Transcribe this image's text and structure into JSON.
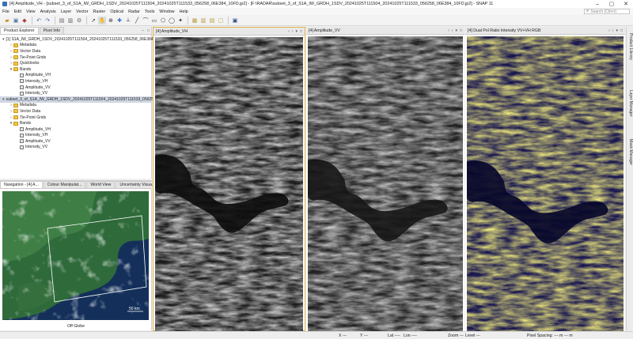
{
  "window": {
    "title": "[4] Amplitude_VH - [subset_3_of_S1A_IW_GRDH_1SDV_20241025T111504_20241025T111533_056258_06E384_10FD.jp2] - [F:\\RADAR\\subset_3_of_S1A_IW_GRDH_1SDV_20241025T111504_20241025T111533_056258_06E384_10FD.jp2] - SNAP 11",
    "minimize": "–",
    "maximize": "▢",
    "close": "✕"
  },
  "menu": [
    "File",
    "Edit",
    "View",
    "Analysis",
    "Layer",
    "Vector",
    "Raster",
    "Optical",
    "Radar",
    "Tools",
    "Window",
    "Help"
  ],
  "search": {
    "placeholder": "Search (Ctrl+I)"
  },
  "left_panel": {
    "tabs": [
      "Product Explorer",
      "Pixel Info"
    ],
    "tree": [
      {
        "indent": 0,
        "toggle": "▾",
        "icon": "product",
        "label": "[1] S1A_IW_GRDH_1SDV_20241025T111504_20241025T111533_056258_06E384_10FD"
      },
      {
        "indent": 1,
        "toggle": "›",
        "icon": "folder",
        "label": "Metadata"
      },
      {
        "indent": 1,
        "toggle": "›",
        "icon": "folder",
        "label": "Vector Data"
      },
      {
        "indent": 1,
        "toggle": "›",
        "icon": "folder",
        "label": "Tie-Point Grids"
      },
      {
        "indent": 1,
        "toggle": "›",
        "icon": "folder",
        "label": "Quicklooks"
      },
      {
        "indent": 1,
        "toggle": "▾",
        "icon": "folder",
        "label": "Bands"
      },
      {
        "indent": 2,
        "toggle": "",
        "icon": "band",
        "label": "Amplitude_VH"
      },
      {
        "indent": 2,
        "toggle": "",
        "icon": "band",
        "label": "Intensity_VH"
      },
      {
        "indent": 2,
        "toggle": "",
        "icon": "band",
        "label": "Amplitude_VV"
      },
      {
        "indent": 2,
        "toggle": "",
        "icon": "band",
        "label": "Intensity_VV"
      },
      {
        "indent": 0,
        "toggle": "▾",
        "icon": "product",
        "label": "subset_3_of_S1A_IW_GRDH_1SDV_20241025T111504_20241025T111533_056258_06E384_10FD",
        "selected": true
      },
      {
        "indent": 1,
        "toggle": "›",
        "icon": "folder",
        "label": "Metadata"
      },
      {
        "indent": 1,
        "toggle": "›",
        "icon": "folder",
        "label": "Vector Data"
      },
      {
        "indent": 1,
        "toggle": "›",
        "icon": "folder",
        "label": "Tie-Point Grids"
      },
      {
        "indent": 1,
        "toggle": "▾",
        "icon": "folder",
        "label": "Bands"
      },
      {
        "indent": 2,
        "toggle": "",
        "icon": "band",
        "label": "Amplitude_VH"
      },
      {
        "indent": 2,
        "toggle": "",
        "icon": "band",
        "label": "Intensity_VH"
      },
      {
        "indent": 2,
        "toggle": "",
        "icon": "band",
        "label": "Amplitude_VV"
      },
      {
        "indent": 2,
        "toggle": "",
        "icon": "band",
        "label": "Intensity_VV"
      }
    ]
  },
  "nav_panel": {
    "tabs": [
      "Navigation - [4] A...",
      "Colour Manipulat...",
      "World View",
      "Uncertainty Visua..."
    ],
    "scale_label": "50 km",
    "footer": "Off Globe"
  },
  "views": [
    {
      "label": "[4] Amplitude_VH",
      "style": "gray"
    },
    {
      "label": "[4] Amplitude_VV",
      "style": "gray"
    },
    {
      "label": "[4] Dual Pol Ratio Intensity VV+VH RGB",
      "style": "rgb"
    }
  ],
  "view_controls": {
    "prev": "‹",
    "next": "›",
    "list": "▾",
    "maximize": "□"
  },
  "right_panels": [
    "Product Library",
    "Layer Manager",
    "Mask Manager"
  ],
  "status": {
    "x": "X ---",
    "y": "Y ---",
    "lat": "Lat ----",
    "lon": "Lon ----",
    "zoom": "Zoom ---",
    "level": "Level ---",
    "pixel_spacing": "Pixel Spacing: --- m --- m"
  },
  "colors": {
    "selected_view_border": "#e3b34a",
    "selected_row": "#cfd6e3",
    "rgb_yellow": "#c9c23a",
    "rgb_blue": "#1a1850"
  }
}
